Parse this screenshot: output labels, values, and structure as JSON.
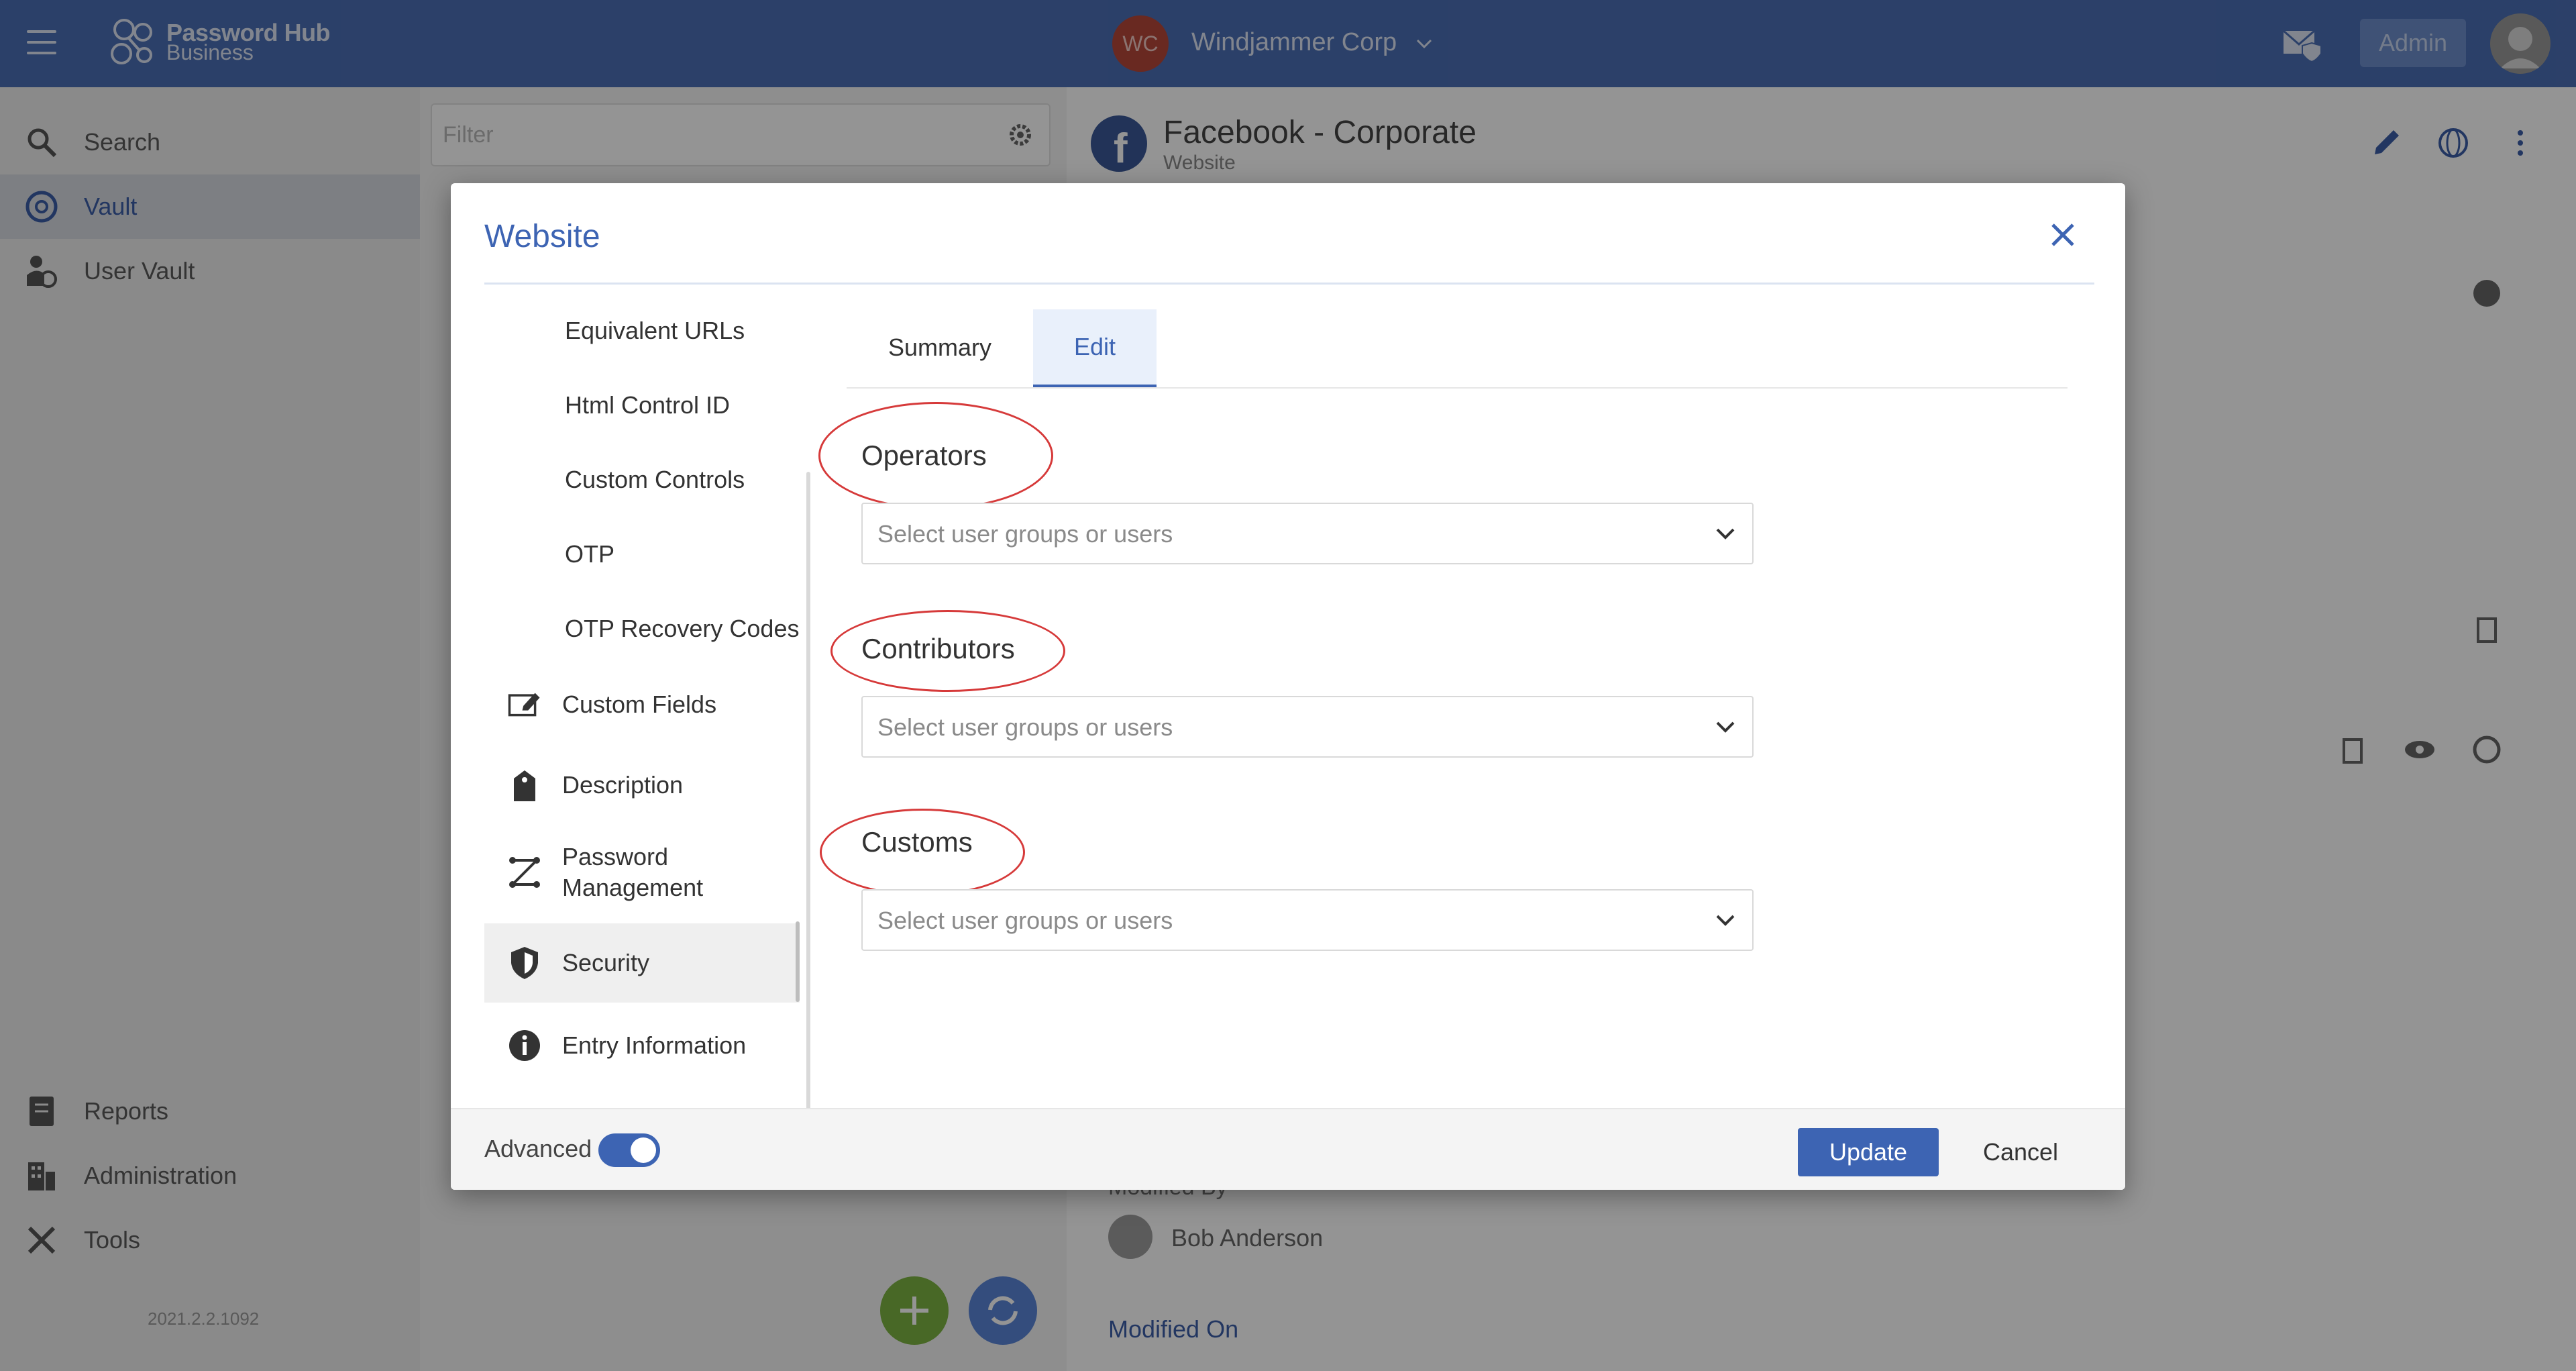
{
  "app": {
    "logo_line1": "Password Hub",
    "logo_line2": "Business"
  },
  "header": {
    "org_initials": "WC",
    "org_name": "Windjammer Corp",
    "admin_label": "Admin"
  },
  "nav": {
    "items": [
      {
        "label": "Search",
        "icon": "search-icon"
      },
      {
        "label": "Vault",
        "icon": "vault-icon",
        "active": true
      },
      {
        "label": "User Vault",
        "icon": "user-vault-icon"
      }
    ],
    "bottom_items": [
      {
        "label": "Reports",
        "icon": "reports-icon"
      },
      {
        "label": "Administration",
        "icon": "administration-icon"
      },
      {
        "label": "Tools",
        "icon": "tools-icon"
      }
    ],
    "version": "2021.2.2.1092"
  },
  "list": {
    "filter_placeholder": "Filter"
  },
  "detail": {
    "title": "Facebook - Corporate",
    "subtitle": "Website",
    "modified_by_label": "Modified By",
    "modified_by_name": "Bob Anderson",
    "modified_on_label": "Modified On"
  },
  "modal": {
    "title": "Website",
    "sidebar": {
      "sub_items": [
        "Equivalent URLs",
        "Html Control ID",
        "Custom Controls",
        "OTP",
        "OTP Recovery Codes"
      ],
      "items": [
        {
          "label": "Custom Fields",
          "icon": "edit-icon"
        },
        {
          "label": "Description",
          "icon": "tag-icon"
        },
        {
          "label": "Password Management",
          "label_line1": "Password",
          "label_line2": "Management",
          "icon": "password-management-icon"
        },
        {
          "label": "Security",
          "icon": "shield-icon",
          "active": true
        },
        {
          "label": "Entry Information",
          "icon": "info-icon"
        }
      ]
    },
    "tabs": [
      {
        "label": "Summary",
        "active": false
      },
      {
        "label": "Edit",
        "active": true
      }
    ],
    "fields": [
      {
        "label": "Operators",
        "placeholder": "Select user groups or users"
      },
      {
        "label": "Contributors",
        "placeholder": "Select user groups or users"
      },
      {
        "label": "Customs",
        "placeholder": "Select user groups or users"
      }
    ],
    "footer": {
      "advanced_label": "Advanced",
      "advanced_on": true,
      "update_label": "Update",
      "cancel_label": "Cancel"
    }
  },
  "colors": {
    "brand": "#4b6fb5",
    "accent": "#3d64b3",
    "annotation": "#d63a3a"
  }
}
